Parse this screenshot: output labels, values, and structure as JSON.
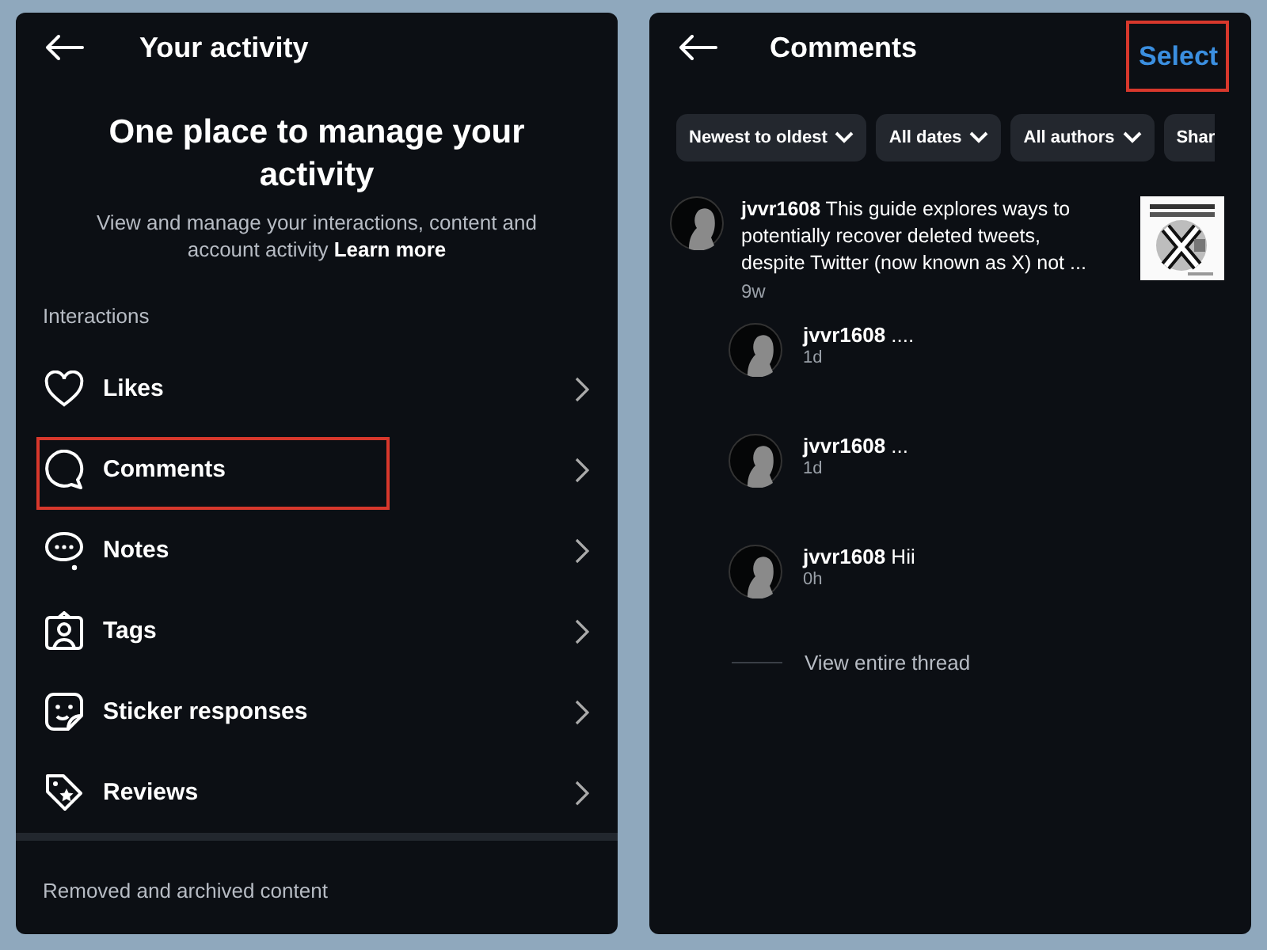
{
  "left": {
    "title": "Your activity",
    "heading": "One place to manage your activity",
    "description": "View and manage your interactions, content and account activity",
    "link": "Learn more",
    "section": "Interactions",
    "items": [
      {
        "label": "Likes",
        "kind": "heart",
        "highlighted": false
      },
      {
        "label": "Comments",
        "kind": "bubble",
        "highlighted": true
      },
      {
        "label": "Notes",
        "kind": "note",
        "highlighted": false
      },
      {
        "label": "Tags",
        "kind": "tag",
        "highlighted": false
      },
      {
        "label": "Sticker responses",
        "kind": "sticker",
        "highlighted": false
      },
      {
        "label": "Reviews",
        "kind": "review",
        "highlighted": false
      }
    ],
    "footer": "Removed and archived content"
  },
  "right": {
    "title": "Comments",
    "action": {
      "label": "Select",
      "highlighted": true
    },
    "filters": [
      {
        "label": "Newest to oldest",
        "dropdown": true
      },
      {
        "label": "All dates",
        "dropdown": true
      },
      {
        "label": "All authors",
        "dropdown": true
      },
      {
        "label": "Shar",
        "dropdown": false
      }
    ],
    "comment": {
      "user": "jvvr1608",
      "text": "This guide explores ways to potentially recover deleted tweets, despite Twitter (now known as X) not ...",
      "time": "9w"
    },
    "replies": [
      {
        "user": "jvvr1608",
        "text": "....",
        "time": "1d"
      },
      {
        "user": "jvvr1608",
        "text": "...",
        "time": "1d"
      },
      {
        "user": "jvvr1608",
        "text": "Hii",
        "time": "0h"
      }
    ],
    "thread_link": "View entire thread"
  }
}
